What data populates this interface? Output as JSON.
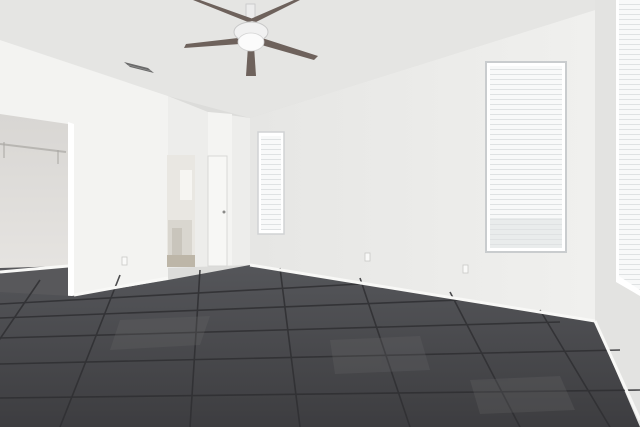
{
  "scene": {
    "type": "photo",
    "subject": "empty-bedroom-interior",
    "colors": {
      "ceiling": "#e8e8e6",
      "wall_back": "#ececea",
      "wall_left": "#f2f2f0",
      "wall_right": "#e4e4e2",
      "floor_tile": "#4a4a4c",
      "grout": "#2e2e30",
      "baseboard": "#f6f6f4",
      "fan_blade": "#6e625c",
      "window_light": "#f7f8f8"
    },
    "icons": [
      "ceiling-fan-icon",
      "air-vent-icon",
      "window-icon",
      "door-icon",
      "closet-rod-icon",
      "outlet-icon"
    ]
  }
}
